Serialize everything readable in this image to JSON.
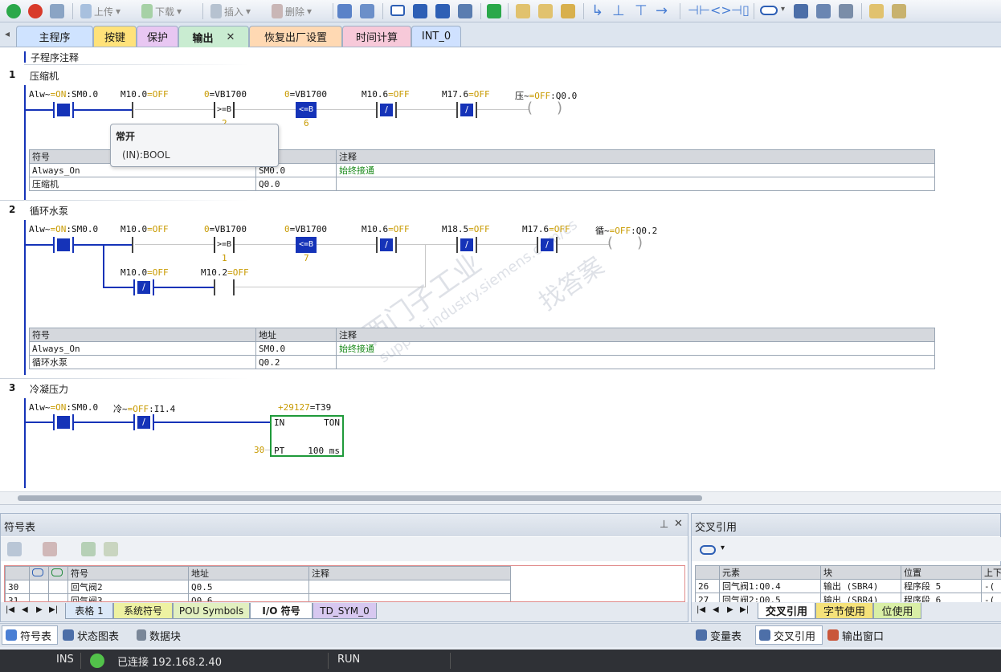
{
  "toolbar": {
    "upload": "上传",
    "download": "下载",
    "insert": "插入",
    "delete": "删除"
  },
  "tabs": [
    {
      "label": "主程序",
      "color": "#cfe3ff"
    },
    {
      "label": "按键",
      "color": "#ffe27a"
    },
    {
      "label": "保护",
      "color": "#e8c7f2"
    },
    {
      "label": "输出",
      "color": "#c9ecd1",
      "active": true
    },
    {
      "label": "恢复出厂设置",
      "color": "#ffd9b3"
    },
    {
      "label": "时间计算",
      "color": "#f7c9d9"
    },
    {
      "label": "INT_0",
      "color": "#cfe1ff"
    }
  ],
  "editor": {
    "subroutine_comment": "子程序注释",
    "networks": [
      {
        "num": "1",
        "title": "压缩机",
        "contacts": [
          {
            "name": "Alw~",
            "state": "=ON",
            "addr": ":SM0.0"
          },
          {
            "name": "M10.0",
            "state": "=OFF",
            "addr": ""
          },
          {
            "name": "0",
            "state": "",
            "addr": "=VB1700",
            "op": ">=B",
            "value": "2"
          },
          {
            "name": "0",
            "state": "",
            "addr": "=VB1700",
            "op": "<=B",
            "value": "6"
          },
          {
            "name": "M10.6",
            "state": "=OFF",
            "addr": "",
            "glyph": "/"
          },
          {
            "name": "M17.6",
            "state": "=OFF",
            "addr": "",
            "glyph": "/"
          }
        ],
        "coil": {
          "name": "压~",
          "state": "=OFF",
          "addr": ":Q0.0"
        },
        "symtable": {
          "headers": [
            "符号",
            "地址",
            "注释"
          ],
          "rows": [
            [
              "Always_On",
              "SM0.0",
              "始终接通"
            ],
            [
              "压缩机",
              "Q0.0",
              ""
            ]
          ]
        }
      },
      {
        "num": "2",
        "title": "循环水泵",
        "contacts": [
          {
            "name": "Alw~",
            "state": "=ON",
            "addr": ":SM0.0"
          },
          {
            "name": "M10.0",
            "state": "=OFF",
            "addr": ""
          },
          {
            "name": "0",
            "state": "",
            "addr": "=VB1700",
            "op": ">=B",
            "value": "1"
          },
          {
            "name": "0",
            "state": "",
            "addr": "=VB1700",
            "op": "<=B",
            "value": "7"
          },
          {
            "name": "M10.6",
            "state": "=OFF",
            "addr": "",
            "glyph": "/"
          },
          {
            "name": "M18.5",
            "state": "=OFF",
            "addr": "",
            "glyph": "/"
          },
          {
            "name": "M17.6",
            "state": "=OFF",
            "addr": "",
            "glyph": "/"
          },
          {
            "name": "M10.0",
            "state": "=OFF",
            "addr": "",
            "glyph": "/"
          },
          {
            "name": "M10.2",
            "state": "=OFF",
            "addr": ""
          }
        ],
        "coil": {
          "name": "循~",
          "state": "=OFF",
          "addr": ":Q0.2"
        },
        "symtable": {
          "headers": [
            "符号",
            "地址",
            "注释"
          ],
          "rows": [
            [
              "Always_On",
              "SM0.0",
              "始终接通"
            ],
            [
              "循环水泵",
              "Q0.2",
              ""
            ]
          ]
        }
      },
      {
        "num": "3",
        "title": "冷凝压力",
        "contacts": [
          {
            "name": "Alw~",
            "state": "=ON",
            "addr": ":SM0.0"
          },
          {
            "name": "冷~",
            "state": "=OFF",
            "addr": ":I1.4",
            "glyph": "/"
          }
        ],
        "timer": {
          "value": "+29127",
          "addr": "=T39",
          "in": "IN",
          "type": "TON",
          "pt_value": "30",
          "pt": "PT",
          "base": "100 ms"
        }
      }
    ],
    "tooltip": {
      "title": "常开",
      "sub": "(IN):BOOL"
    }
  },
  "watermark": {
    "line1": "西门子工业",
    "line2": "support.industry.siemens.com/cs",
    "line3": "找答案"
  },
  "symbol_panel": {
    "title": "符号表",
    "headers": [
      "符号",
      "地址",
      "注释"
    ],
    "rows": [
      [
        "30",
        "回气阀2",
        "Q0.5",
        ""
      ],
      [
        "31",
        "回气阀3",
        "Q0.6",
        ""
      ]
    ],
    "sheets": [
      "表格 1",
      "系统符号",
      "POU Symbols",
      "I/O 符号",
      "TD_SYM_0"
    ]
  },
  "xref_panel": {
    "title": "交叉引用",
    "headers": [
      "元素",
      "块",
      "位置",
      "上下"
    ],
    "rows": [
      [
        "26",
        "回气阀1:Q0.4",
        "输出 (SBR4)",
        "程序段 5",
        "-("
      ],
      [
        "27",
        "回气阀2:Q0.5",
        "输出 (SBR4)",
        "程序段 6",
        "-("
      ]
    ],
    "sheets": [
      "交叉引用",
      "字节使用",
      "位使用"
    ]
  },
  "bottom_tabs": {
    "left": [
      "符号表",
      "状态图表",
      "数据块"
    ],
    "right": [
      "变量表",
      "交叉引用",
      "输出窗口"
    ]
  },
  "status": {
    "mode": "INS",
    "connection": "已连接 192.168.2.40",
    "run": "RUN"
  }
}
